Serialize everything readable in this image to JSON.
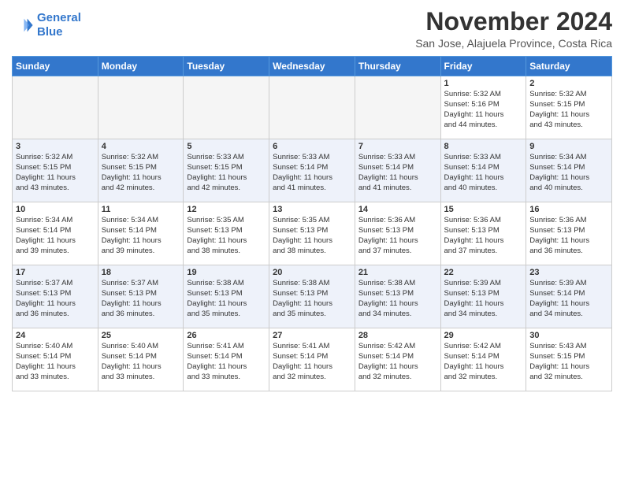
{
  "header": {
    "logo_line1": "General",
    "logo_line2": "Blue",
    "month": "November 2024",
    "location": "San Jose, Alajuela Province, Costa Rica"
  },
  "weekdays": [
    "Sunday",
    "Monday",
    "Tuesday",
    "Wednesday",
    "Thursday",
    "Friday",
    "Saturday"
  ],
  "weeks": [
    [
      {
        "day": "",
        "info": ""
      },
      {
        "day": "",
        "info": ""
      },
      {
        "day": "",
        "info": ""
      },
      {
        "day": "",
        "info": ""
      },
      {
        "day": "",
        "info": ""
      },
      {
        "day": "1",
        "info": "Sunrise: 5:32 AM\nSunset: 5:16 PM\nDaylight: 11 hours\nand 44 minutes."
      },
      {
        "day": "2",
        "info": "Sunrise: 5:32 AM\nSunset: 5:15 PM\nDaylight: 11 hours\nand 43 minutes."
      }
    ],
    [
      {
        "day": "3",
        "info": "Sunrise: 5:32 AM\nSunset: 5:15 PM\nDaylight: 11 hours\nand 43 minutes."
      },
      {
        "day": "4",
        "info": "Sunrise: 5:32 AM\nSunset: 5:15 PM\nDaylight: 11 hours\nand 42 minutes."
      },
      {
        "day": "5",
        "info": "Sunrise: 5:33 AM\nSunset: 5:15 PM\nDaylight: 11 hours\nand 42 minutes."
      },
      {
        "day": "6",
        "info": "Sunrise: 5:33 AM\nSunset: 5:14 PM\nDaylight: 11 hours\nand 41 minutes."
      },
      {
        "day": "7",
        "info": "Sunrise: 5:33 AM\nSunset: 5:14 PM\nDaylight: 11 hours\nand 41 minutes."
      },
      {
        "day": "8",
        "info": "Sunrise: 5:33 AM\nSunset: 5:14 PM\nDaylight: 11 hours\nand 40 minutes."
      },
      {
        "day": "9",
        "info": "Sunrise: 5:34 AM\nSunset: 5:14 PM\nDaylight: 11 hours\nand 40 minutes."
      }
    ],
    [
      {
        "day": "10",
        "info": "Sunrise: 5:34 AM\nSunset: 5:14 PM\nDaylight: 11 hours\nand 39 minutes."
      },
      {
        "day": "11",
        "info": "Sunrise: 5:34 AM\nSunset: 5:14 PM\nDaylight: 11 hours\nand 39 minutes."
      },
      {
        "day": "12",
        "info": "Sunrise: 5:35 AM\nSunset: 5:13 PM\nDaylight: 11 hours\nand 38 minutes."
      },
      {
        "day": "13",
        "info": "Sunrise: 5:35 AM\nSunset: 5:13 PM\nDaylight: 11 hours\nand 38 minutes."
      },
      {
        "day": "14",
        "info": "Sunrise: 5:36 AM\nSunset: 5:13 PM\nDaylight: 11 hours\nand 37 minutes."
      },
      {
        "day": "15",
        "info": "Sunrise: 5:36 AM\nSunset: 5:13 PM\nDaylight: 11 hours\nand 37 minutes."
      },
      {
        "day": "16",
        "info": "Sunrise: 5:36 AM\nSunset: 5:13 PM\nDaylight: 11 hours\nand 36 minutes."
      }
    ],
    [
      {
        "day": "17",
        "info": "Sunrise: 5:37 AM\nSunset: 5:13 PM\nDaylight: 11 hours\nand 36 minutes."
      },
      {
        "day": "18",
        "info": "Sunrise: 5:37 AM\nSunset: 5:13 PM\nDaylight: 11 hours\nand 36 minutes."
      },
      {
        "day": "19",
        "info": "Sunrise: 5:38 AM\nSunset: 5:13 PM\nDaylight: 11 hours\nand 35 minutes."
      },
      {
        "day": "20",
        "info": "Sunrise: 5:38 AM\nSunset: 5:13 PM\nDaylight: 11 hours\nand 35 minutes."
      },
      {
        "day": "21",
        "info": "Sunrise: 5:38 AM\nSunset: 5:13 PM\nDaylight: 11 hours\nand 34 minutes."
      },
      {
        "day": "22",
        "info": "Sunrise: 5:39 AM\nSunset: 5:13 PM\nDaylight: 11 hours\nand 34 minutes."
      },
      {
        "day": "23",
        "info": "Sunrise: 5:39 AM\nSunset: 5:14 PM\nDaylight: 11 hours\nand 34 minutes."
      }
    ],
    [
      {
        "day": "24",
        "info": "Sunrise: 5:40 AM\nSunset: 5:14 PM\nDaylight: 11 hours\nand 33 minutes."
      },
      {
        "day": "25",
        "info": "Sunrise: 5:40 AM\nSunset: 5:14 PM\nDaylight: 11 hours\nand 33 minutes."
      },
      {
        "day": "26",
        "info": "Sunrise: 5:41 AM\nSunset: 5:14 PM\nDaylight: 11 hours\nand 33 minutes."
      },
      {
        "day": "27",
        "info": "Sunrise: 5:41 AM\nSunset: 5:14 PM\nDaylight: 11 hours\nand 32 minutes."
      },
      {
        "day": "28",
        "info": "Sunrise: 5:42 AM\nSunset: 5:14 PM\nDaylight: 11 hours\nand 32 minutes."
      },
      {
        "day": "29",
        "info": "Sunrise: 5:42 AM\nSunset: 5:14 PM\nDaylight: 11 hours\nand 32 minutes."
      },
      {
        "day": "30",
        "info": "Sunrise: 5:43 AM\nSunset: 5:15 PM\nDaylight: 11 hours\nand 32 minutes."
      }
    ]
  ]
}
